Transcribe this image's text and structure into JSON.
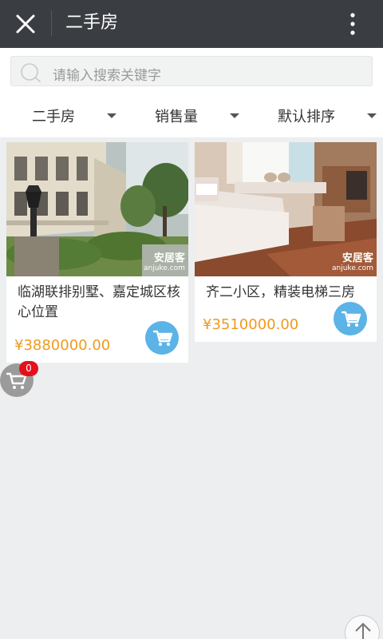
{
  "header": {
    "title": "二手房",
    "close_icon": "close-icon",
    "more_icon": "more-vertical-icon"
  },
  "search": {
    "placeholder": "请输入搜索关键字",
    "icon": "search-icon"
  },
  "filters": [
    {
      "label": "二手房"
    },
    {
      "label": "销售量"
    },
    {
      "label": "默认排序"
    }
  ],
  "products": [
    {
      "title": "临湖联排别墅、嘉定城区核心位置",
      "price": "¥3880000.00",
      "watermark_main": "安居客",
      "watermark_sub": "anjuke.com"
    },
    {
      "title": "齐二小区，精装电梯三房",
      "price": "¥3510000.00",
      "watermark_main": "安居客",
      "watermark_sub": "anjuke.com"
    }
  ],
  "cart": {
    "count": "0",
    "icon": "cart-icon"
  },
  "back_to_top_icon": "arrow-up-icon",
  "colors": {
    "header": "#3a3d41",
    "price": "#ef9a1e",
    "cart_button": "#5bb3e6",
    "badge": "#e5101b",
    "background": "#eceeef"
  }
}
